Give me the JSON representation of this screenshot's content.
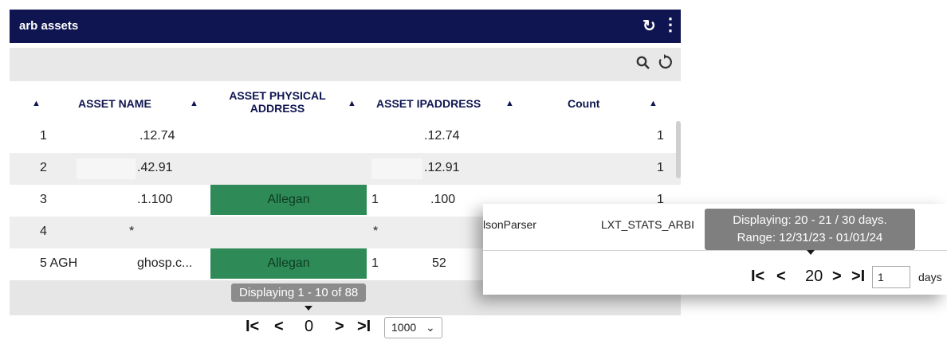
{
  "widget": {
    "title": "arb assets",
    "refresh_glyph": "↻",
    "kebab_glyph": "⋮",
    "icons": [
      "refresh-icon",
      "kebab-menu-icon",
      "search-icon",
      "reset-icon"
    ]
  },
  "table": {
    "sort_glyph": "▲",
    "headers": {
      "asset_name": "ASSET NAME",
      "asset_physical_address_1": "ASSET PHYSICAL",
      "asset_physical_address_2": "ADDRESS",
      "asset_ipaddress": "ASSET IPADDRESS",
      "count": "Count"
    },
    "rows": [
      {
        "num": "1",
        "name": ".12.74",
        "address": "",
        "ip": ".12.74",
        "count": "1"
      },
      {
        "num": "2",
        "name": ".42.91",
        "address": "",
        "ip": ".12.91",
        "count": "1"
      },
      {
        "num": "3",
        "name": ".1.100",
        "address": "Allegan",
        "ip_prefix": "1",
        "ip": ".100",
        "count": "1"
      },
      {
        "num": "4",
        "name": "*",
        "address": "",
        "ip": "*",
        "count": ""
      },
      {
        "num": "5 AGH",
        "name": "ghosp.c...",
        "address": "Allegan",
        "ip_prefix": "1",
        "ip": "52",
        "count": ""
      }
    ],
    "accent_color": "#2e8b57",
    "title_color": "#0f1550"
  },
  "footer": {
    "display_tip": "Displaying 1 - 10 of 88",
    "first": "I<",
    "prev": "<",
    "page": "0",
    "next": ">",
    "last": ">I",
    "page_size": "1000",
    "dropdown_glyph": "⌄"
  },
  "popup": {
    "parser": "lsonParser",
    "stat": "LXT_STATS_ARBI",
    "tip_line1": "Displaying: 20 - 21 / 30 days.",
    "tip_line2": "Range: 12/31/23 - 01/01/24",
    "first": "I<",
    "prev": "<",
    "page": "20",
    "next": ">",
    "last": ">I",
    "days_value": "1",
    "days_label": "days"
  }
}
